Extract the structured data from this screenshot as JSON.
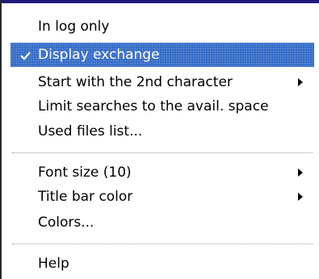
{
  "menu": {
    "items": [
      {
        "label": "In log only",
        "checked": false,
        "submenu": false
      },
      {
        "label": "Display exchange",
        "checked": true,
        "submenu": false
      },
      {
        "label": "Start with the 2nd character",
        "checked": false,
        "submenu": true
      },
      {
        "label": "Limit searches to the avail. space",
        "checked": false,
        "submenu": false
      },
      {
        "label": "Used files list...",
        "checked": false,
        "submenu": false
      },
      {
        "label": "Font size (10)",
        "checked": false,
        "submenu": true
      },
      {
        "label": "Title bar color",
        "checked": false,
        "submenu": true
      },
      {
        "label": "Colors...",
        "checked": false,
        "submenu": false
      },
      {
        "label": "Help",
        "checked": false,
        "submenu": false
      }
    ]
  },
  "colors": {
    "highlight": "#3169c6",
    "highlight_text": "#ffffff",
    "separator": "#9a9a8a"
  },
  "icons": {
    "check": "checkmark-icon",
    "submenu": "submenu-arrow-icon"
  }
}
